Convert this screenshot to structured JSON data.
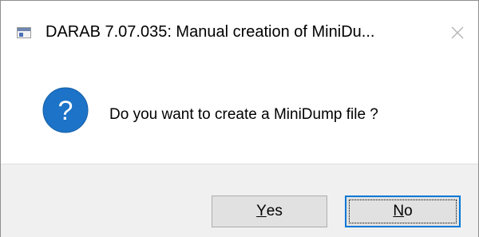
{
  "window": {
    "title": "DARAB 7.07.035: Manual creation of MiniDu...",
    "app_icon": "application-window-icon",
    "close_icon": "close-icon"
  },
  "message": {
    "icon": "question-icon",
    "text": "Do you want to create a MiniDump file ?"
  },
  "buttons": {
    "yes": {
      "mnemonic": "Y",
      "rest": "es"
    },
    "no": {
      "mnemonic": "N",
      "rest": "o"
    }
  },
  "colors": {
    "question_icon_fill": "#1c73c7",
    "focus_border": "#0078d7",
    "footer_background": "#f0f0f0"
  }
}
